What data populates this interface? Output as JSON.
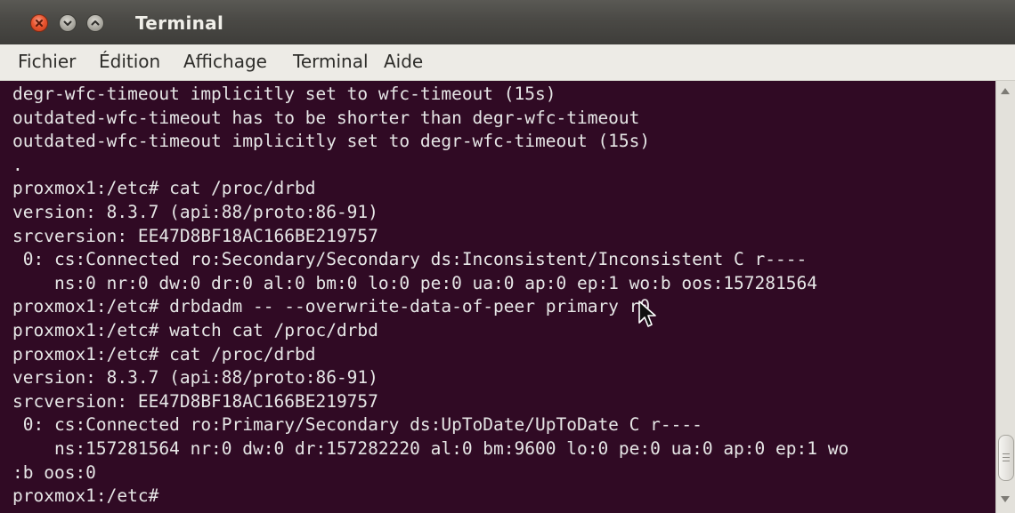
{
  "window": {
    "title": "Terminal",
    "buttons": [
      "close",
      "minimize",
      "maximize"
    ]
  },
  "menubar": {
    "items": [
      "Fichier",
      "Édition",
      "Affichage",
      "Terminal",
      "Aide"
    ]
  },
  "terminal": {
    "background": "#300a24",
    "foreground": "#e6e6e6",
    "lines": [
      "degr-wfc-timeout implicitly set to wfc-timeout (15s)",
      "outdated-wfc-timeout has to be shorter than degr-wfc-timeout",
      "outdated-wfc-timeout implicitly set to degr-wfc-timeout (15s)",
      ".",
      "proxmox1:/etc# cat /proc/drbd",
      "version: 8.3.7 (api:88/proto:86-91)",
      "srcversion: EE47D8BF18AC166BE219757",
      " 0: cs:Connected ro:Secondary/Secondary ds:Inconsistent/Inconsistent C r----",
      "    ns:0 nr:0 dw:0 dr:0 al:0 bm:0 lo:0 pe:0 ua:0 ap:0 ep:1 wo:b oos:157281564",
      "proxmox1:/etc# drbdadm -- --overwrite-data-of-peer primary r0",
      "proxmox1:/etc# watch cat /proc/drbd",
      "proxmox1:/etc# cat /proc/drbd",
      "version: 8.3.7 (api:88/proto:86-91)",
      "srcversion: EE47D8BF18AC166BE219757",
      " 0: cs:Connected ro:Primary/Secondary ds:UpToDate/UpToDate C r----",
      "    ns:157281564 nr:0 dw:0 dr:157282220 al:0 bm:9600 lo:0 pe:0 ua:0 ap:0 ep:1 wo",
      ":b oos:0",
      "proxmox1:/etc#"
    ]
  },
  "scrollbar": {
    "up_icon": "arrow-up-icon",
    "down_icon": "arrow-down-icon"
  }
}
